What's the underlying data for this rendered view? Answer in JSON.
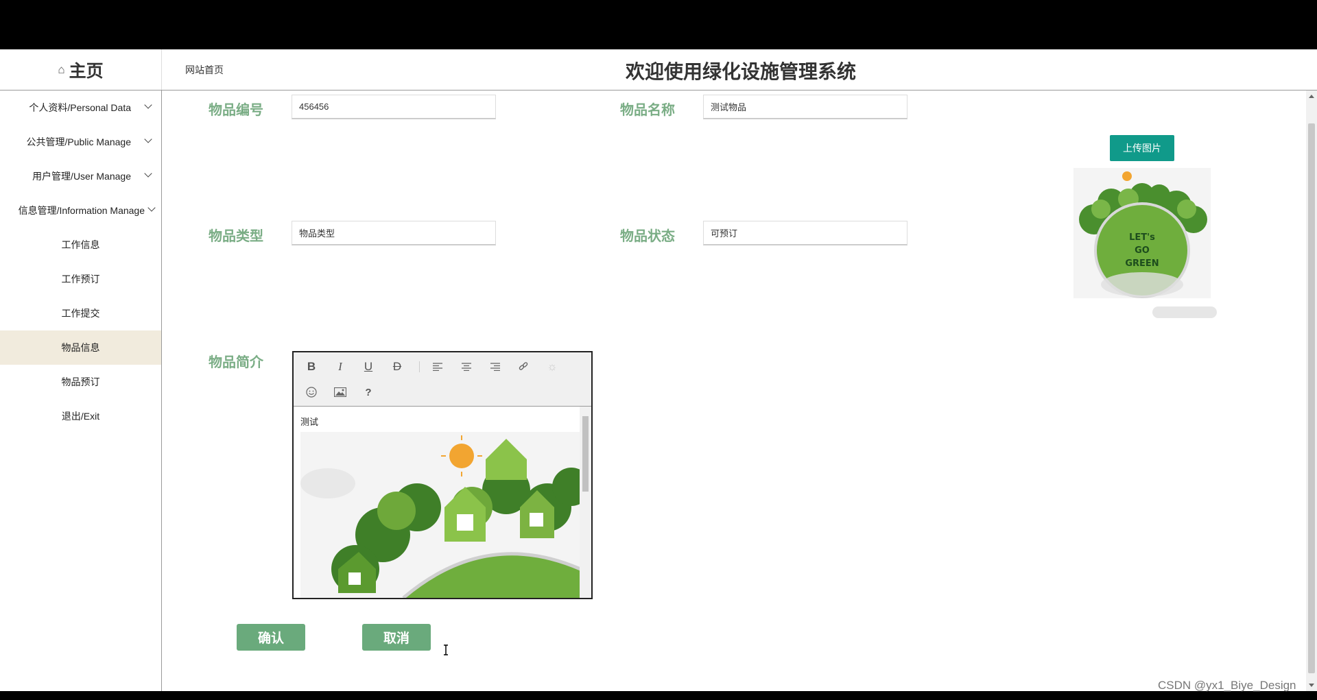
{
  "header": {
    "home_label": "主页",
    "breadcrumb": "网站首页",
    "site_title": "欢迎使用绿化设施管理系统"
  },
  "sidebar": {
    "items": [
      {
        "label": "个人资料/Personal Data",
        "expandable": true
      },
      {
        "label": "公共管理/Public Manage",
        "expandable": true
      },
      {
        "label": "用户管理/User Manage",
        "expandable": true
      },
      {
        "label": "信息管理/Information Manage",
        "expandable": true
      },
      {
        "label": "工作信息",
        "expandable": false
      },
      {
        "label": "工作预订",
        "expandable": false
      },
      {
        "label": "工作提交",
        "expandable": false
      },
      {
        "label": "物品信息",
        "expandable": false,
        "active": true
      },
      {
        "label": "物品预订",
        "expandable": false
      },
      {
        "label": "退出/Exit",
        "expandable": false
      }
    ]
  },
  "form": {
    "item_no": {
      "label": "物品编号",
      "value": "456456"
    },
    "item_name": {
      "label": "物品名称",
      "value": "测试物品"
    },
    "item_type": {
      "label": "物品类型",
      "value": "物品类型"
    },
    "item_status": {
      "label": "物品状态",
      "value": "可预订"
    },
    "item_intro": {
      "label": "物品简介",
      "editor_text": "测试"
    },
    "upload_label": "上传图片",
    "preview_text": [
      "LET's",
      "GO",
      "GREEN"
    ],
    "confirm_label": "确认",
    "cancel_label": "取消"
  },
  "editor_toolbar": [
    "bold-icon",
    "italic-icon",
    "underline-icon",
    "strikethrough-icon",
    "align-left-icon",
    "align-center-icon",
    "align-right-icon",
    "link-icon",
    "unlink-icon",
    "emoji-icon",
    "image-icon",
    "help-icon"
  ],
  "watermark": "CSDN @yx1_Biye_Design",
  "colors": {
    "label_green": "#7aad85",
    "upload_teal": "#109a8a",
    "button_green": "#6aaa7c",
    "active_bg": "#f1ebdd"
  }
}
